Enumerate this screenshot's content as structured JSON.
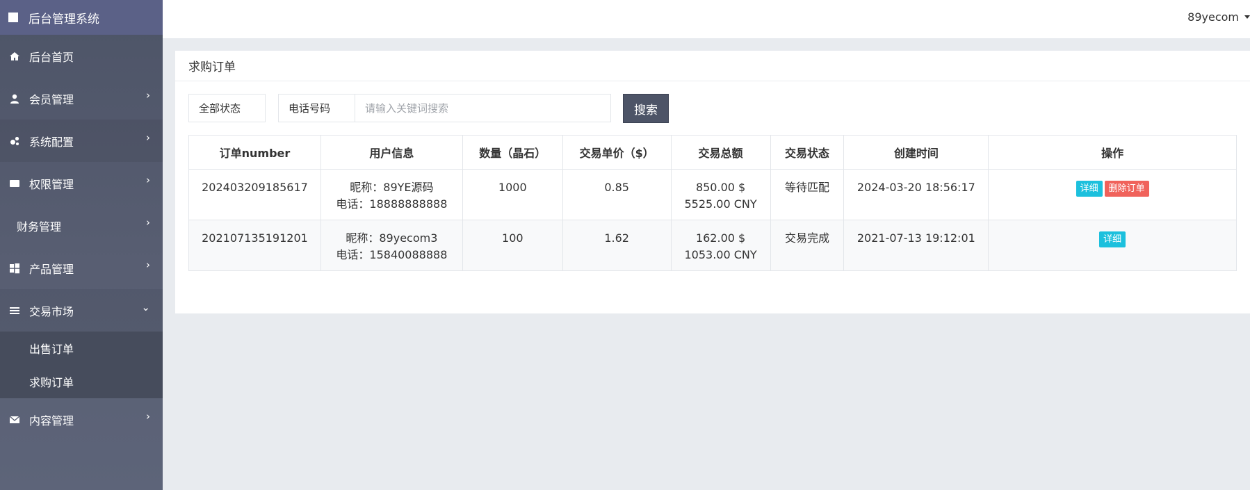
{
  "sidebar": {
    "brand": "后台管理系统",
    "items": [
      {
        "label": "后台首页",
        "icon": "home-icon"
      },
      {
        "label": "会员管理",
        "icon": "user-icon"
      },
      {
        "label": "系统配置",
        "icon": "cogs-icon"
      },
      {
        "label": "权限管理",
        "icon": "id-card-icon"
      },
      {
        "label": "财务管理",
        "icon": ""
      },
      {
        "label": "产品管理",
        "icon": "windows-icon"
      },
      {
        "label": "交易市场",
        "icon": "bars-icon"
      },
      {
        "label": "内容管理",
        "icon": "envelope-icon"
      }
    ],
    "submenu": [
      "出售订单",
      "求购订单"
    ]
  },
  "header": {
    "user": "89yecom"
  },
  "card": {
    "title": "求购订单",
    "filters": {
      "status": "全部状态",
      "type": "电话号码",
      "placeholder": "请输入关键词搜索",
      "search_label": "搜索"
    },
    "columns": [
      "订单number",
      "用户信息",
      "数量（晶石）",
      "交易单价（$）",
      "交易总额",
      "交易状态",
      "创建时间",
      "操作"
    ],
    "rows": [
      {
        "order": "202403209185617",
        "nickname": "昵称：89YE源码",
        "phone": "电话：18888888888",
        "qty": "1000",
        "price": "0.85",
        "total_usd": "850.00 $",
        "total_cny": "5525.00 CNY",
        "status": "等待匹配",
        "created": "2024-03-20 18:56:17",
        "detail": "详细",
        "delete": "删除订单"
      },
      {
        "order": "202107135191201",
        "nickname": "昵称：89yecom3",
        "phone": "电话：15840088888",
        "qty": "100",
        "price": "1.62",
        "total_usd": "162.00 $",
        "total_cny": "1053.00 CNY",
        "status": "交易完成",
        "created": "2021-07-13 19:12:01",
        "detail": "详细"
      }
    ]
  },
  "colors": {
    "sidebar": "#585e72",
    "brand": "#5b6187",
    "submenu": "#464c5c",
    "search_button": "#4d5467",
    "info": "#1cc0dd",
    "danger": "#f0625b"
  }
}
